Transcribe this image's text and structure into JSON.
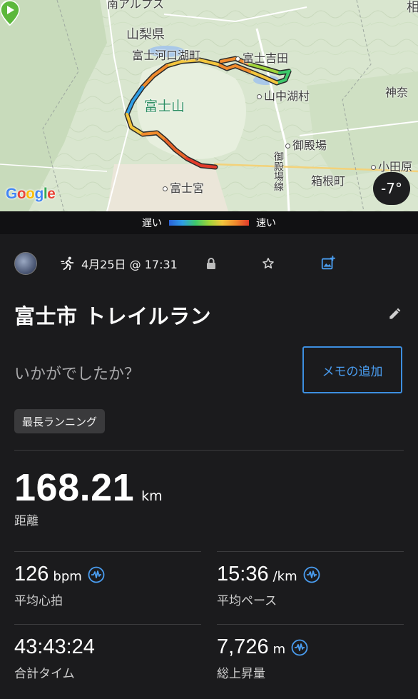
{
  "map": {
    "labels": {
      "top_cut": "南アルプス",
      "yamanashi": "山梨県",
      "kawaguchiko": "富士河口湖町",
      "fujiyoshida": "富士吉田",
      "yamanakako": "山中湖村",
      "fujisan": "富士山",
      "kanagawa": "神奈",
      "gotemba": "御殿場",
      "gotemba_line": "御殿場線",
      "odawara": "小田原",
      "hakone": "箱根町",
      "fujinomiya": "富士宮",
      "sagami": "相"
    },
    "google_logo": [
      "G",
      "o",
      "o",
      "g",
      "l",
      "e"
    ],
    "google_colors": [
      "#4285F4",
      "#EA4335",
      "#FBBC05",
      "#4285F4",
      "#34A853",
      "#EA4335"
    ],
    "temperature": "-7°"
  },
  "legend": {
    "slow": "遅い",
    "fast": "速い"
  },
  "activity": {
    "date": "4月25日 @ 17:31",
    "title": "富士市 トレイルラン",
    "question": "いかがでしたか？",
    "memo_button": "メモの追加",
    "badge": "最長ランニング"
  },
  "distance": {
    "value": "168.21",
    "unit": "km",
    "label": "距離"
  },
  "stats": {
    "heart_rate": {
      "value": "126",
      "unit": "bpm",
      "label": "平均心拍"
    },
    "pace": {
      "value": "15:36",
      "unit": "/km",
      "label": "平均ペース"
    },
    "total_time": {
      "value": "43:43:24",
      "unit": "",
      "label": "合計タイム"
    },
    "ascent": {
      "value": "7,726",
      "unit": "m",
      "label": "総上昇量"
    }
  },
  "colors": {
    "accent_blue": "#3d8fe0",
    "background": "#1b1b1d",
    "route_red": "#e23b2b",
    "route_green": "#5cb83c"
  }
}
